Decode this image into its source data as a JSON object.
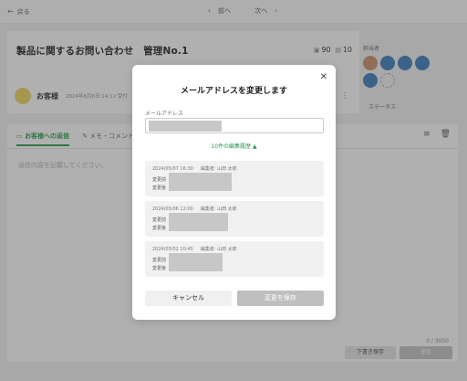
{
  "topbar": {
    "back_label": "戻る",
    "prev_label": "前へ",
    "next_label": "次へ"
  },
  "ticket": {
    "title": "製品に関するお問い合わせ　管理No.1",
    "comment_count": "90",
    "file_count": "10",
    "customer_name": "お客様",
    "customer_date": "2024年8月6日 14:12 受付"
  },
  "right_panel": {
    "assignee_label": "担当者",
    "status_label": "ステータス"
  },
  "reply": {
    "tab_reply": "お客様への返信",
    "tab_memo": "メモ・コメント",
    "placeholder": "返信内容を記載してください。",
    "counter": "0 / 3000",
    "draft_label": "下書き保存",
    "send_label": "送信"
  },
  "modal": {
    "title": "メールアドレスを変更します",
    "email_label": "メールアドレス",
    "history_toggle": "10件の編集履歴",
    "history": [
      {
        "date": "2024/05/07 16:30",
        "editor": "編集者: 山田 太郎",
        "before_label": "変更前",
        "after_label": "変更後",
        "redact_width": 0.35
      },
      {
        "date": "2024/05/06 12:00",
        "editor": "編集者: 山田 太郎",
        "before_label": "変更前",
        "after_label": "変更後",
        "redact_width": 0.33
      },
      {
        "date": "2024/05/02 10:45",
        "editor": "編集者: 山田 太郎",
        "before_label": "変更前",
        "after_label": "変更後",
        "redact_width": 0.3
      }
    ],
    "cancel_label": "キャンセル",
    "save_label": "変更を保存"
  },
  "colors": {
    "accent": "#2a9a4f",
    "disabled": "#bfbfbf"
  }
}
